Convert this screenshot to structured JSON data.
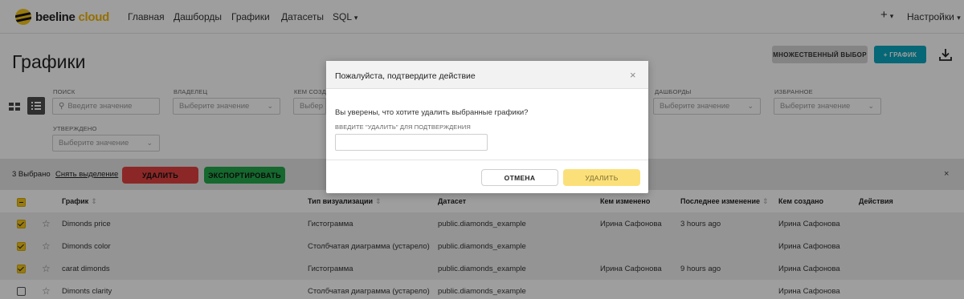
{
  "nav": {
    "logo_main": "beeline",
    "logo_accent": "cloud",
    "items": [
      "Главная",
      "Дашборды",
      "Графики",
      "Датасеты",
      "SQL"
    ],
    "sql_caret": "▾",
    "add": "+",
    "add_caret": "▾",
    "settings": "Настройки",
    "settings_caret": "▾"
  },
  "page": {
    "title": "Графики",
    "multi_select_label": "МНОЖЕСТВЕННЫЙ ВЫБОР",
    "add_chart_label": "+ ГРАФИК"
  },
  "filters": [
    {
      "label": "ПОИСК",
      "placeholder": "Введите значение",
      "type": "search"
    },
    {
      "label": "ВЛАДЕЛЕЦ",
      "placeholder": "Выберите значение",
      "type": "select"
    },
    {
      "label": "КЕМ СОЗДА",
      "placeholder": "Выбер",
      "type": "select"
    },
    {
      "label": "ДАШБОРДЫ",
      "placeholder": "Выберите значение",
      "type": "select"
    },
    {
      "label": "ИЗБРАННОЕ",
      "placeholder": "Выберите значение",
      "type": "select"
    },
    {
      "label": "УТВЕРЖДЕНО",
      "placeholder": "Выберите значение",
      "type": "select"
    }
  ],
  "selection": {
    "count": "3 Выбрано",
    "clear": "Снять выделение",
    "delete": "УДАЛИТЬ",
    "export": "ЭКСПОРТИРОВАТЬ",
    "close": "×"
  },
  "table": {
    "columns": [
      "График",
      "Тип визуализации",
      "Датасет",
      "Кем изменено",
      "Последнее изменение",
      "Кем создано",
      "Действия"
    ],
    "sort_glyph": "⇕",
    "rows": [
      {
        "selected": true,
        "name": "Dimonds price",
        "type": "Гистограмма",
        "dataset": "public.diamonds_example",
        "modified_by": "Ирина Сафонова",
        "modified": "3 hours ago",
        "created_by": "Ирина Сафонова"
      },
      {
        "selected": true,
        "name": "Dimonds color",
        "type": "Столбчатая диаграмма (устарело)",
        "dataset": "public.diamonds_example",
        "modified_by": "",
        "modified": "",
        "created_by": "Ирина Сафонова"
      },
      {
        "selected": true,
        "name": "carat dimonds",
        "type": "Гистограмма",
        "dataset": "public.diamonds_example",
        "modified_by": "Ирина Сафонова",
        "modified": "9 hours ago",
        "created_by": "Ирина Сафонова"
      },
      {
        "selected": false,
        "name": "Dimonts clarity",
        "type": "Столбчатая диаграмма (устарело)",
        "dataset": "public.diamonds_example",
        "modified_by": "",
        "modified": "",
        "created_by": "Ирина Сафонова"
      }
    ]
  },
  "modal": {
    "title": "Пожалуйста, подтвердите действие",
    "close": "×",
    "message": "Вы уверены, что хотите удалить выбранные графики?",
    "hint": "ВВЕДИТЕ \"УДАЛИТЬ\" ДЛЯ ПОДТВЕРЖДЕНИЯ",
    "input_value": "",
    "cancel": "ОТМЕНА",
    "confirm": "УДАЛИТЬ"
  },
  "colors": {
    "accent_yellow": "#f5c518",
    "teal": "#0aa6be",
    "delete_red": "#e0413f",
    "export_green": "#22a84b"
  }
}
